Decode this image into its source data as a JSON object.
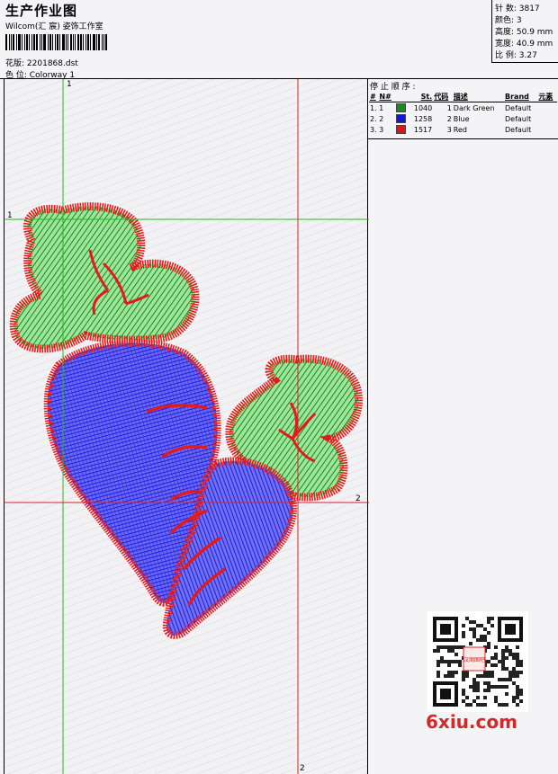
{
  "header": {
    "title": "生产作业图",
    "studio": "Wilcom(汇 宸) 姿饰工作室",
    "design_label": "花版:",
    "design_file": "2201868.dst",
    "colorway_label": "色 位:",
    "colorway": "Colorway 1"
  },
  "stats": {
    "stitches": "针 数: 3817",
    "colors": "颜色: 3",
    "height": "高度: 50.9 mm",
    "width": "宽度: 40.9 mm",
    "ratio": "比 例: 3.27"
  },
  "stop_sequence": {
    "title": "停 止 顺 序 :",
    "headers": [
      "#",
      "N#",
      "St.",
      "代码",
      "描述",
      "Brand",
      "元素"
    ],
    "rows": [
      {
        "idx": "1. 1",
        "stitches": "1040",
        "code": "1",
        "desc": "Dark Green",
        "brand": "Default",
        "color": "#1e8a1e"
      },
      {
        "idx": "2. 2",
        "stitches": "1258",
        "code": "2",
        "desc": "Blue",
        "brand": "Default",
        "color": "#1515dd"
      },
      {
        "idx": "3. 3",
        "stitches": "1517",
        "code": "3",
        "desc": "Red",
        "brand": "Default",
        "color": "#e01515"
      }
    ]
  },
  "guides": {
    "label_1": "1",
    "label_2": "2"
  },
  "watermark": {
    "site": "6xiu.com",
    "stamp": "汉阁图吧"
  }
}
